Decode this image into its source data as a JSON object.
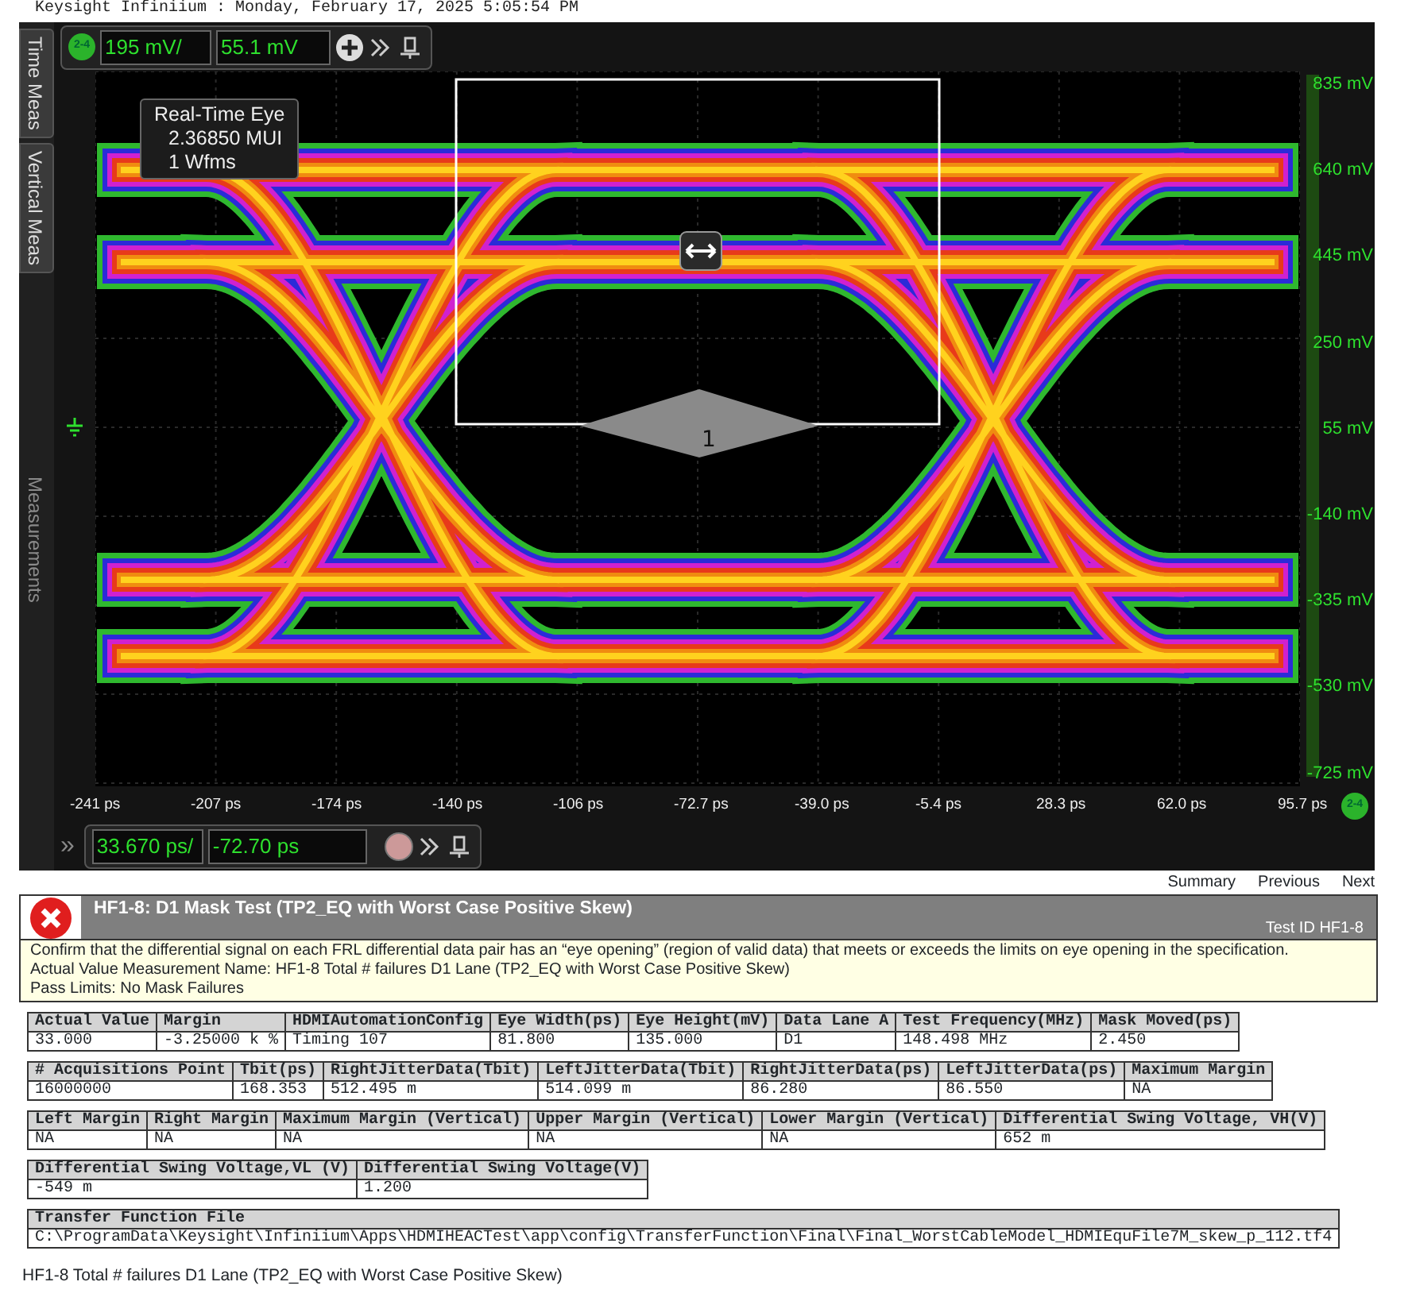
{
  "window": {
    "title": "Keysight Infiniium : Monday, February 17, 2025 5:05:54 PM"
  },
  "scope": {
    "side_tabs": [
      {
        "label": "Time Meas",
        "disabled": false
      },
      {
        "label": "Vertical Meas",
        "disabled": false
      },
      {
        "label": "Measurements",
        "disabled": true
      }
    ],
    "vertical_toolbar": {
      "channel": "2-4",
      "scale": "195 mV/",
      "offset": "55.1 mV"
    },
    "legend": [
      "Real-Time Eye",
      "2.36850 MUI",
      "1 Wfms"
    ],
    "mask_label": "1",
    "y_ticks": [
      "835 mV",
      "640 mV",
      "445 mV",
      "250 mV",
      "55 mV",
      "-140 mV",
      "-335 mV",
      "-530 mV",
      "-725 mV"
    ],
    "x_ticks": [
      "-241 ps",
      "-207 ps",
      "-174 ps",
      "-140 ps",
      "-106 ps",
      "-72.7 ps",
      "-39.0 ps",
      "-5.4 ps",
      "28.3 ps",
      "62.0 ps",
      "95.7 ps"
    ],
    "x_channel": "2-4",
    "horizontal_toolbar": {
      "expand": "»",
      "scale": "33.670 ps/",
      "position": "-72.70 ps"
    }
  },
  "report": {
    "nav": [
      "Summary",
      "Previous",
      "Next"
    ],
    "result": {
      "failed": true,
      "title": "HF1-8: D1 Mask Test (TP2_EQ with Worst Case Positive Skew)",
      "test_id": "Test ID HF1-8"
    },
    "description": [
      "Confirm that the differential signal on each FRL differential data pair has an “eye opening” (region of valid data) that meets or exceeds the limits on eye opening in the specification.",
      "Actual Value Measurement Name: HF1-8 Total # failures D1 Lane (TP2_EQ with Worst Case Positive Skew)",
      "Pass Limits: No Mask Failures"
    ],
    "tables": [
      [
        {
          "header": "Actual Value",
          "value": "33.000"
        },
        {
          "header": "Margin",
          "value": "-3.25000 k %"
        },
        {
          "header": "HDMIAutomationConfig",
          "value": "Timing 107"
        },
        {
          "header": "Eye Width(ps)",
          "value": "81.800"
        },
        {
          "header": "Eye Height(mV)",
          "value": "135.000"
        },
        {
          "header": "Data Lane A",
          "value": "D1"
        },
        {
          "header": "Test Frequency(MHz)",
          "value": "148.498 MHz"
        },
        {
          "header": "Mask Moved(ps)",
          "value": "2.450"
        }
      ],
      [
        {
          "header": "# Acquisitions Point",
          "value": "16000000"
        },
        {
          "header": "Tbit(ps)",
          "value": "168.353"
        },
        {
          "header": "RightJitterData(Tbit)",
          "value": "512.495 m"
        },
        {
          "header": "LeftJitterData(Tbit)",
          "value": "514.099 m"
        },
        {
          "header": "RightJitterData(ps)",
          "value": "86.280"
        },
        {
          "header": "LeftJitterData(ps)",
          "value": "86.550"
        },
        {
          "header": "Maximum Margin",
          "value": "NA"
        }
      ],
      [
        {
          "header": "Left Margin",
          "value": "NA"
        },
        {
          "header": "Right Margin",
          "value": "NA"
        },
        {
          "header": "Maximum Margin (Vertical)",
          "value": "NA"
        },
        {
          "header": "Upper Margin (Vertical)",
          "value": "NA"
        },
        {
          "header": "Lower Margin (Vertical)",
          "value": "NA"
        },
        {
          "header": "Differential Swing Voltage, VH(V)",
          "value": "652 m"
        }
      ],
      [
        {
          "header": "Differential Swing Voltage,VL (V)",
          "value": "-549 m"
        },
        {
          "header": "Differential Swing Voltage(V)",
          "value": "1.200"
        }
      ],
      [
        {
          "header": "Transfer Function File",
          "value": "C:\\ProgramData\\Keysight\\Infiniium\\Apps\\HDMIHEACTest\\app\\config\\TransferFunction\\Final\\Final_WorstCableModel_HDMIEquFile7M_skew_p_112.tf4"
        }
      ]
    ],
    "footer": "HF1-8 Total # failures D1 Lane (TP2_EQ with Worst Case Positive Skew)"
  }
}
